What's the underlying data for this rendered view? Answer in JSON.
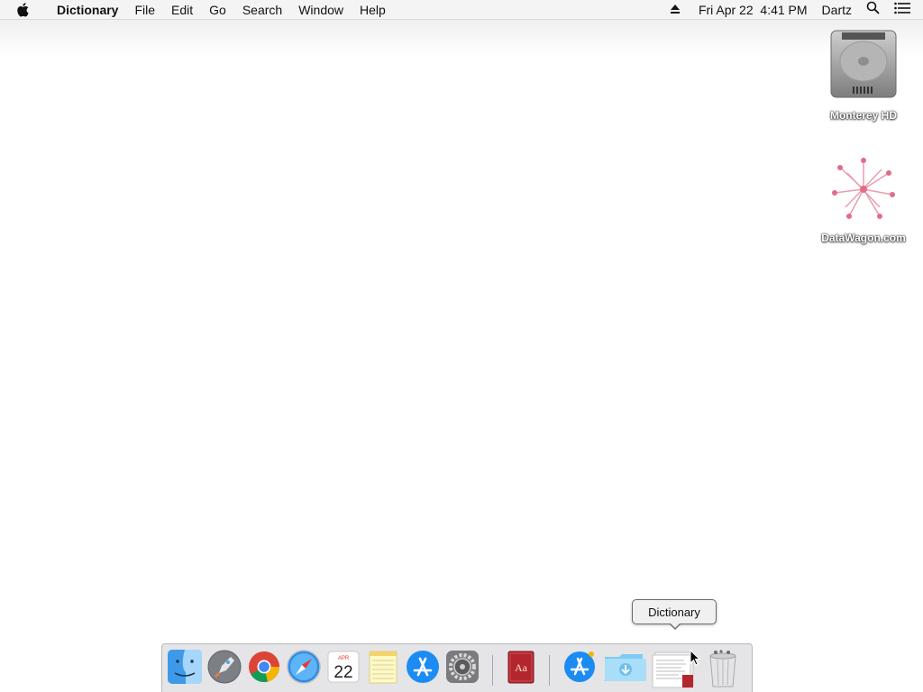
{
  "menubar": {
    "app_name": "Dictionary",
    "menus": [
      "File",
      "Edit",
      "Go",
      "Search",
      "Window",
      "Help"
    ],
    "date_time": "Fri Apr 22  4:41 PM",
    "user": "Dartz"
  },
  "desktop": {
    "icons": [
      {
        "label": "Monterey HD",
        "icon": "hard-drive-icon"
      },
      {
        "label": "DataWagon.com",
        "icon": "network-share-icon"
      }
    ]
  },
  "tooltip": {
    "text": "Dictionary"
  },
  "dock": {
    "items": [
      {
        "name": "Finder",
        "icon": "finder-icon",
        "running": true
      },
      {
        "name": "Launchpad",
        "icon": "launchpad-icon",
        "running": false
      },
      {
        "name": "Google Chrome",
        "icon": "chrome-icon",
        "running": true
      },
      {
        "name": "Safari",
        "icon": "safari-icon",
        "running": true
      },
      {
        "name": "Calendar",
        "icon": "calendar-icon",
        "running": false,
        "month": "APR",
        "day": "22"
      },
      {
        "name": "Notes",
        "icon": "notes-icon",
        "running": false
      },
      {
        "name": "App Store",
        "icon": "app-store-icon",
        "running": false
      },
      {
        "name": "System Preferences",
        "icon": "system-preferences-icon",
        "running": false
      },
      {
        "name": "Dictionary",
        "icon": "dictionary-icon",
        "running": true,
        "glyph": "Aa"
      },
      {
        "name": "Applications",
        "icon": "applications-folder-icon",
        "running": false
      },
      {
        "name": "Downloads",
        "icon": "downloads-folder-icon",
        "running": false
      },
      {
        "name": "Dictionary Document",
        "icon": "document-stack-icon",
        "running": false
      },
      {
        "name": "Trash",
        "icon": "trash-icon",
        "running": false
      }
    ]
  },
  "colors": {
    "menubar_bg": "#f4f4f4",
    "dock_bg": "#e1e1e4",
    "desktop_bg": "#ffffff"
  }
}
